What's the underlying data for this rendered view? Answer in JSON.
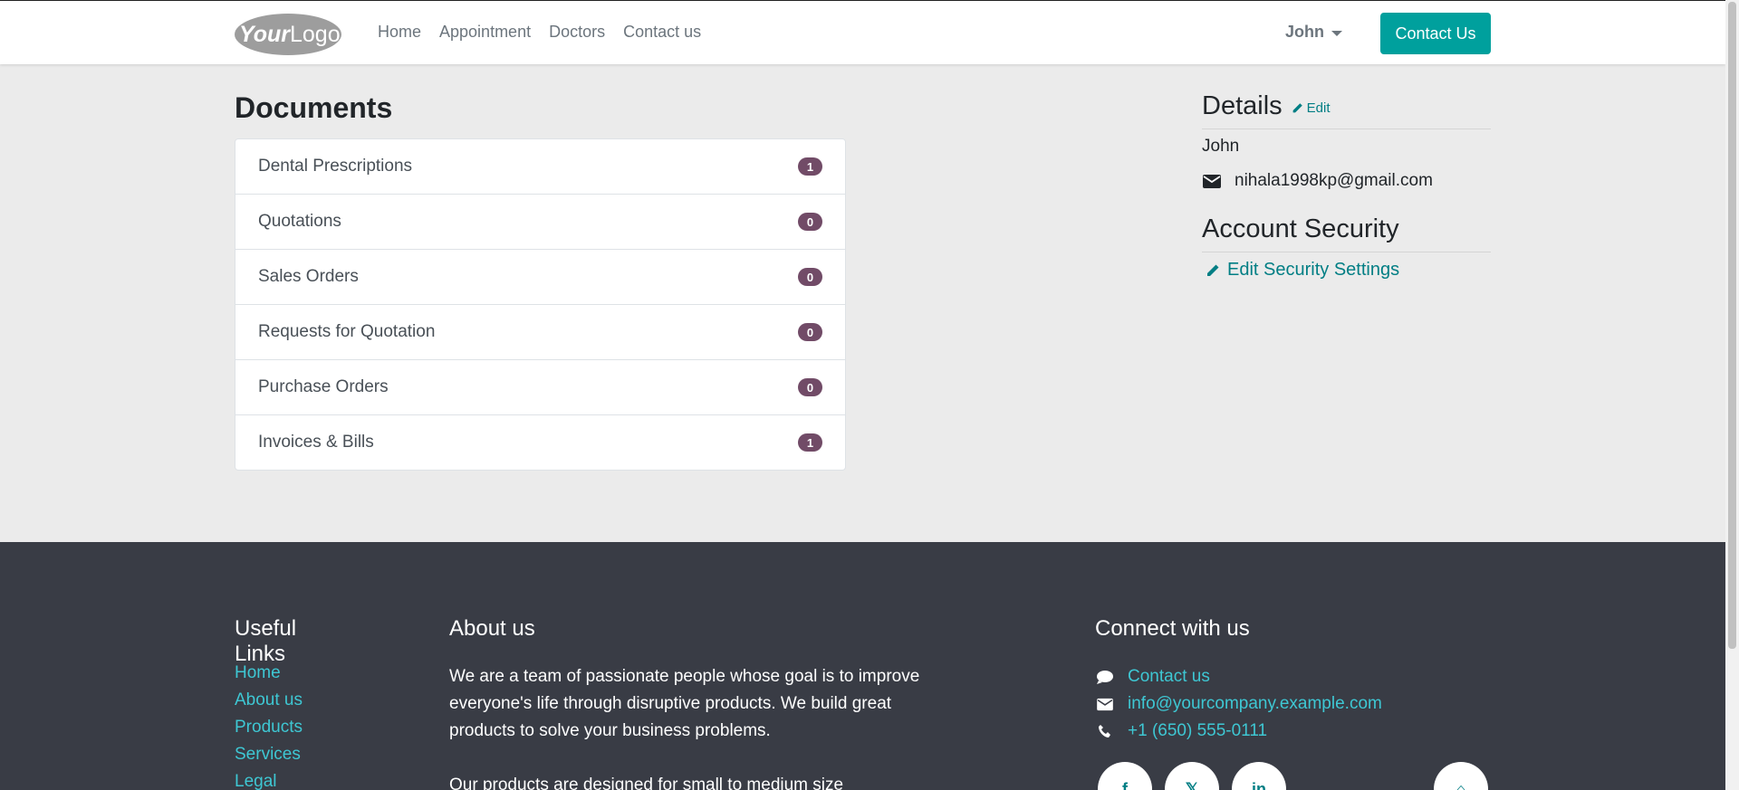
{
  "header": {
    "logo_text": "YourLogo",
    "nav": [
      "Home",
      "Appointment",
      "Doctors",
      "Contact us"
    ],
    "user": "John",
    "contact_button": "Contact Us"
  },
  "documents": {
    "title": "Documents",
    "items": [
      {
        "label": "Dental Prescriptions",
        "count": "1"
      },
      {
        "label": "Quotations",
        "count": "0"
      },
      {
        "label": "Sales Orders",
        "count": "0"
      },
      {
        "label": "Requests for Quotation",
        "count": "0"
      },
      {
        "label": "Purchase Orders",
        "count": "0"
      },
      {
        "label": "Invoices & Bills",
        "count": "1"
      }
    ]
  },
  "details": {
    "title": "Details",
    "edit_label": "Edit",
    "name": "John",
    "email": "nihala1998kp@gmail.com"
  },
  "security": {
    "title": "Account Security",
    "link": "Edit Security Settings"
  },
  "footer": {
    "useful_title": "Useful Links",
    "useful_links": [
      "Home",
      "About us",
      "Products",
      "Services",
      "Legal"
    ],
    "about_title": "About us",
    "about_text": "We are a team of passionate people whose goal is to improve everyone's life through disruptive products. We build great products to solve your business problems.",
    "about_text2": "Our products are designed for small to medium size",
    "connect_title": "Connect with us",
    "connect": {
      "contact": "Contact us",
      "email": "info@yourcompany.example.com",
      "phone": "+1 (650) 555-0111"
    },
    "social": [
      "facebook-icon",
      "x-icon",
      "linkedin-icon",
      "home-icon"
    ]
  },
  "colors": {
    "accent": "#00a09d",
    "badge": "#714b67",
    "link": "#017e84",
    "footer_bg": "#393c45",
    "footer_link": "#3ec7d3"
  }
}
